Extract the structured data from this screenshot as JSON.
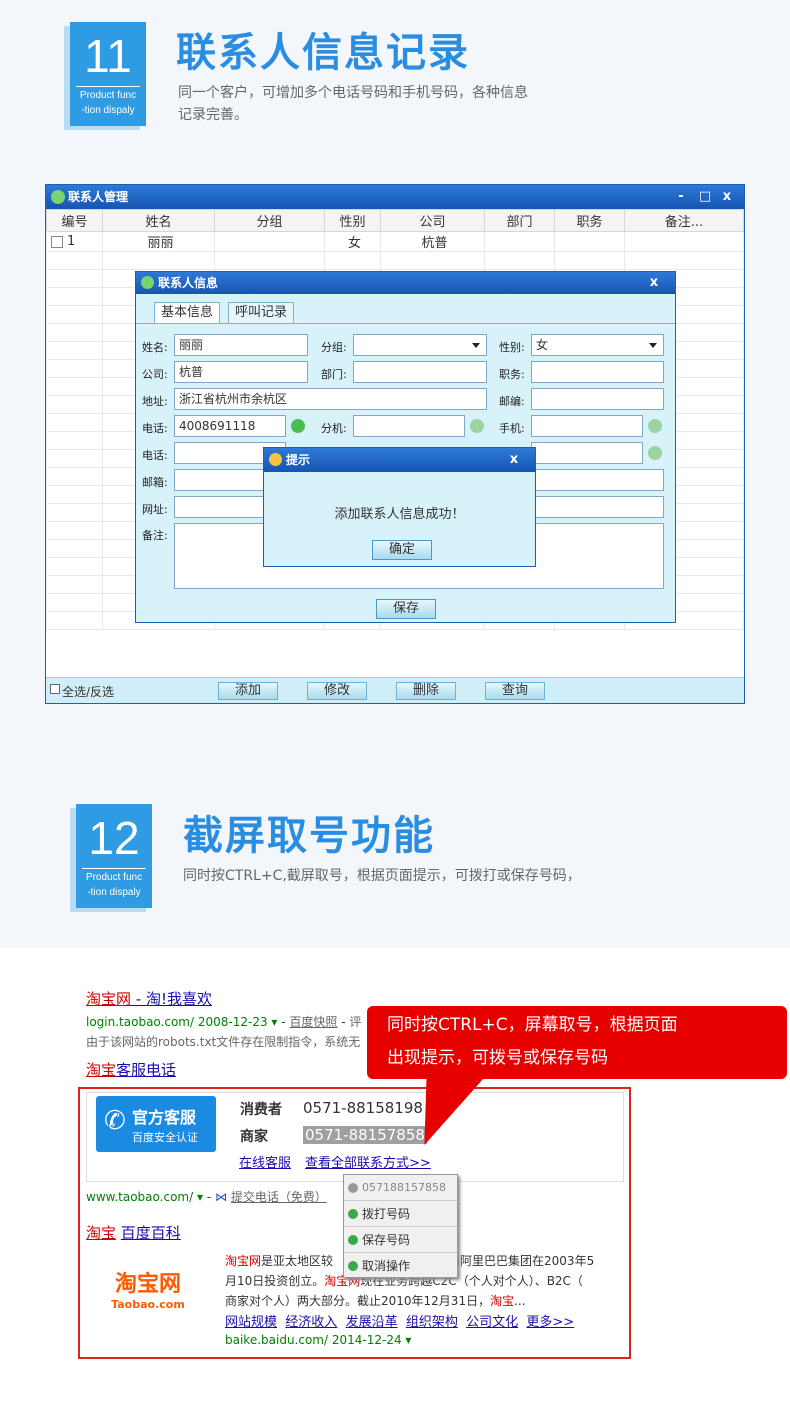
{
  "sections": [
    {
      "num": "11",
      "badge_line1": "Product func",
      "badge_line2": "-tion dispaly",
      "title": "联系人信息记录",
      "desc1": "同一个客户，可增加多个电话号码和手机号码，各种信息",
      "desc2": "记录完善。"
    },
    {
      "num": "12",
      "badge_line1": "Product func",
      "badge_line2": "-tion dispaly",
      "title": "截屏取号功能",
      "desc1": "同时按CTRL+C,截屏取号，根据页面提示，可拨打或保存号码，"
    }
  ],
  "window": {
    "title": "联系人管理",
    "ctrl_min": "-",
    "ctrl_max": "□",
    "ctrl_close": "x",
    "columns": [
      "编号",
      "姓名",
      "分组",
      "性别",
      "公司",
      "部门",
      "职务",
      "备注..."
    ],
    "rows": [
      [
        "1",
        "丽丽",
        "",
        "女",
        "杭普",
        "",
        "",
        ""
      ]
    ],
    "footer": {
      "select_all": "全选/反选",
      "add": "添加",
      "edit": "修改",
      "delete": "删除",
      "query": "查询"
    }
  },
  "contact_dialog": {
    "title": "联系人信息",
    "close": "x",
    "tabs": [
      "基本信息",
      "呼叫记录"
    ],
    "labels": {
      "name": "姓名:",
      "group": "分组:",
      "gender": "性别:",
      "company": "公司:",
      "dept": "部门:",
      "position": "职务:",
      "address": "地址:",
      "zip": "邮编:",
      "phone1": "电话:",
      "ext": "分机:",
      "mobile": "手机:",
      "phone2": "电话:",
      "email": "邮箱:",
      "website": "网址:",
      "remark": "备注:"
    },
    "values": {
      "name": "丽丽",
      "group": "",
      "gender": "女",
      "company": "杭普",
      "address": "浙江省杭州市余杭区",
      "phone1": "4008691118"
    },
    "save": "保存"
  },
  "prompt_dialog": {
    "title": "提示",
    "close": "x",
    "message": "添加联系人信息成功！",
    "ok": "确定"
  },
  "browser": {
    "r1_title_a": "淘宝网",
    "r1_title_b": " - 淘!我喜欢",
    "r1_url": "login.taobao.com/ 2008-12-23",
    "r1_snapshot": "百度快照",
    "r1_eval": "评",
    "r1_desc": "由于该网站的robots.txt文件存在限制指令，系统无",
    "r2_title_a": "淘宝",
    "r2_title_b": "客服电话",
    "kefu_line1": "官方客服",
    "kefu_line2": "百度安全认证",
    "consumer_label": "消费者",
    "consumer_num": "0571-88158198",
    "merchant_label": "商家",
    "merchant_num": "0571-88157858",
    "online_service": "在线客服",
    "view_all": "查看全部联系方式>>",
    "r2_url": "www.taobao.com/",
    "submit_phone": "提交电话（免费）",
    "r3_title_a": "淘宝",
    "r3_title_b": "百度百科",
    "r3_desc1_a": "淘宝网",
    "r3_desc1_b": "是亚太地区较",
    "r3_desc1_c": "由阿里巴巴集团在2003年5",
    "r3_desc2_a": "月10日投资创立。",
    "r3_desc2_b": "淘宝网",
    "r3_desc2_c": "现在业务跨越C2C（个人对个人）、B2C（",
    "r3_desc3_a": "商家对个人）两大部分。截止2010年12月31日，",
    "r3_desc3_b": "淘宝",
    "r3_desc3_c": "...",
    "r3_links": [
      "网站规模",
      "经济收入",
      "发展沿革",
      "组织架构",
      "公司文化",
      "更多>>"
    ],
    "r3_url": "baike.baidu.com/ 2014-12-24",
    "logo_cn": "淘宝网",
    "logo_en": "Taobao.com"
  },
  "context_menu": {
    "header": "057188157858",
    "items": [
      "拨打号码",
      "保存号码",
      "取消操作"
    ]
  },
  "callout": {
    "line1": "同时按CTRL+C，屏幕取号，根据页面",
    "line2": "出现提示，可拨号或保存号码"
  }
}
